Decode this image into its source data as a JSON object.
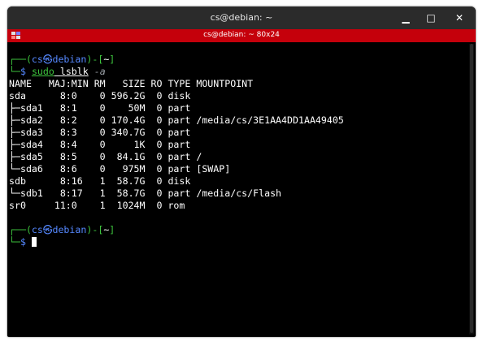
{
  "window": {
    "title": "cs@debian: ~",
    "tab_title": "cs@debian: ~ 80x24",
    "controls": {
      "minimize": "▁",
      "maximize": "□",
      "close": "✕"
    }
  },
  "prompt1": {
    "top": "┌──(",
    "user": "cs㉿debian",
    "mid": ")-[",
    "path": "~",
    "end": "]",
    "bottom": "└─",
    "symbol": "$ ",
    "cmd": "sudo",
    "args": " lsblk",
    "flag": " -a"
  },
  "output": [
    "NAME   MAJ:MIN RM   SIZE RO TYPE MOUNTPOINT",
    "sda      8:0    0 596.2G  0 disk",
    "├─sda1   8:1    0    50M  0 part",
    "├─sda2   8:2    0 170.4G  0 part /media/cs/3E1AA4DD1AA49405",
    "├─sda3   8:3    0 340.7G  0 part",
    "├─sda4   8:4    0     1K  0 part",
    "├─sda5   8:5    0  84.1G  0 part /",
    "└─sda6   8:6    0   975M  0 part [SWAP]",
    "sdb      8:16   1  58.7G  0 disk",
    "└─sdb1   8:17   1  58.7G  0 part /media/cs/Flash",
    "sr0     11:0    1  1024M  0 rom"
  ],
  "prompt2": {
    "top": "┌──(",
    "user": "cs㉿debian",
    "mid": ")-[",
    "path": "~",
    "end": "]",
    "bottom": "└─",
    "symbol": "$ "
  }
}
